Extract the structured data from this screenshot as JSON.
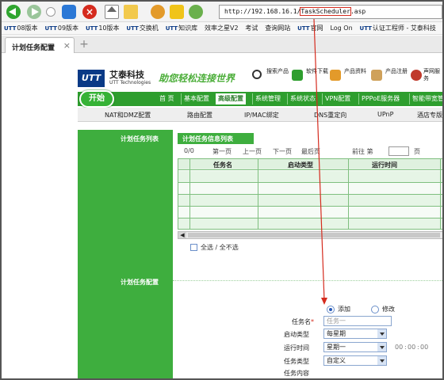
{
  "browser": {
    "url_prefix": "http://192.168.16.1/",
    "url_highlight": "TaskScheduler",
    "url_suffix": ".asp",
    "bookmarks": [
      {
        "logo": "UTT",
        "label": "08版本"
      },
      {
        "logo": "UTT",
        "label": "09版本"
      },
      {
        "logo": "UTT",
        "label": "10版本"
      },
      {
        "logo": "UTT",
        "label": "交换机"
      },
      {
        "logo": "UTT",
        "label": "知识库"
      },
      {
        "logo": "",
        "label": "效率之星V2"
      },
      {
        "logo": "",
        "label": "考试"
      },
      {
        "logo": "",
        "label": "查询网站"
      },
      {
        "logo": "UTT",
        "label": "官网"
      },
      {
        "logo": "",
        "label": "Log On"
      },
      {
        "logo": "UTT",
        "label": "认证工程师 - 艾泰科技"
      }
    ],
    "tab_label": "计划任务配置",
    "tab_close": "×",
    "new_tab": "+"
  },
  "header": {
    "logo_text": "UTT",
    "brand": "艾泰科技",
    "brand_sub": "UTT Technologies",
    "slogan": "助您轻松连接世界",
    "links": [
      "搜索产品",
      "软件下载",
      "产品资料",
      "产品注册",
      "声网服务"
    ]
  },
  "nav": {
    "start": "开始",
    "items": [
      "首 页",
      "基本配置",
      "高级配置",
      "系统管理",
      "系统状态",
      "VPN配置",
      "PPPoE服务器",
      "智能带宽管理"
    ],
    "active_index": 2
  },
  "subnav": {
    "items": [
      "NAT和DMZ配置",
      "路由配置",
      "IP/MAC绑定",
      "DNS重定向",
      "UPnP",
      "酒店专版"
    ]
  },
  "left": {
    "list_label": "计划任务列表",
    "config_label": "计划任务配置"
  },
  "list": {
    "title": "计划任务信息列表",
    "counter": "0/0",
    "first": "第一页",
    "prev": "上一页",
    "next": "下一页",
    "last": "最后页",
    "goto": "前往 第",
    "page_unit": "页",
    "columns": [
      "任务名",
      "启动类型",
      "运行时间"
    ],
    "row_count": 5,
    "scroll_arrow": "◀",
    "selectall": "全选 / 全不选"
  },
  "form": {
    "add": "添加",
    "modify": "修改",
    "mode_selected": "add",
    "name_label": "任务名",
    "required_mark": "*",
    "name_placeholder": "任务一",
    "start_type_label": "启动类型",
    "start_type_value": "每星期",
    "run_time_label": "运行时间",
    "run_day_value": "星期一",
    "hour": "00",
    "minute": "00",
    "second": "00",
    "time_sep": ":",
    "task_type_label": "任务类型",
    "task_type_value": "自定义",
    "task_content_label": "任务内容"
  },
  "colors": {
    "brand_green": "#3eae3e",
    "nav_green": "#2e9e2e",
    "annotation_red": "#d52b1e"
  }
}
